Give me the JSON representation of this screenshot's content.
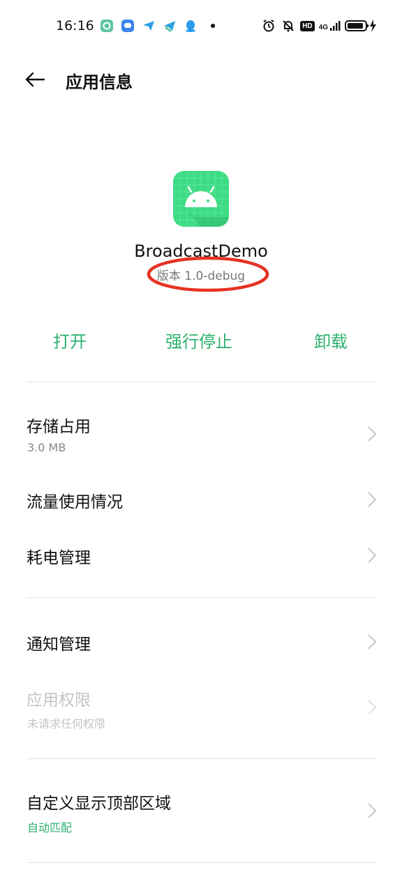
{
  "status_bar": {
    "time": "16:16",
    "network_label": "4G",
    "hd_label": "HD"
  },
  "header": {
    "title": "应用信息"
  },
  "app": {
    "name": "BroadcastDemo",
    "version": "版本 1.0-debug",
    "icon": "android-app-icon"
  },
  "actions": {
    "open": "打开",
    "force_stop": "强行停止",
    "uninstall": "卸载"
  },
  "settings": {
    "storage": {
      "title": "存储占用",
      "subtitle": "3.0 MB"
    },
    "data_usage": {
      "title": "流量使用情况"
    },
    "battery": {
      "title": "耗电管理"
    },
    "notifications": {
      "title": "通知管理"
    },
    "permissions": {
      "title": "应用权限",
      "subtitle": "未请求任何权限"
    },
    "display_top": {
      "title": "自定义显示顶部区域",
      "subtitle": "自动匹配"
    }
  },
  "colors": {
    "accent": "#2db16e",
    "annotation": "#e53222",
    "android_green": "#3ddc84"
  }
}
